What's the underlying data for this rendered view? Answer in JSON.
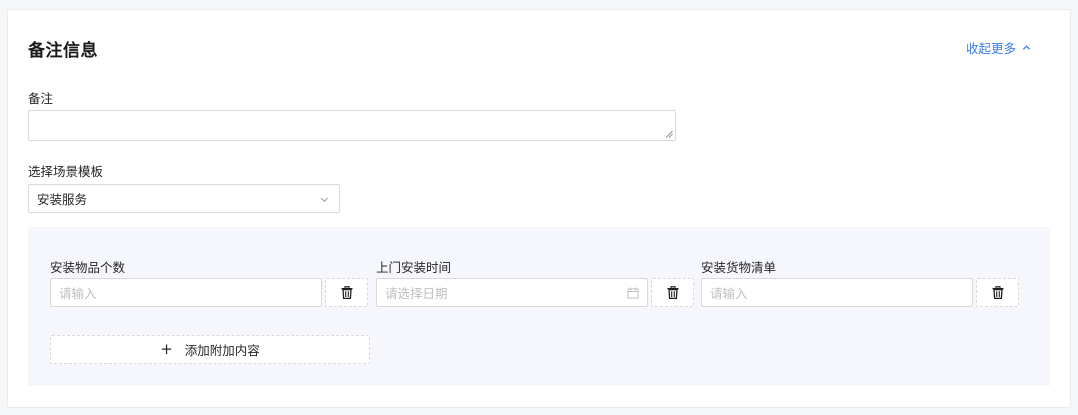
{
  "section": {
    "title": "备注信息",
    "collapse_label": "收起更多"
  },
  "remark": {
    "label": "备注",
    "value": ""
  },
  "scene": {
    "label": "选择场景模板",
    "selected": "安装服务"
  },
  "fields": [
    {
      "label": "安装物品个数",
      "placeholder": "请输入"
    },
    {
      "label": "上门安装时间",
      "placeholder": "请选择日期"
    },
    {
      "label": "安装货物清单",
      "placeholder": "请输入"
    }
  ],
  "add_button": {
    "icon": "+",
    "label": "添加附加内容"
  },
  "colors": {
    "link": "#3a7ff0",
    "panel_bg": "#f5f7fc",
    "border": "#d9d9d9",
    "placeholder": "#bfbfbf"
  }
}
